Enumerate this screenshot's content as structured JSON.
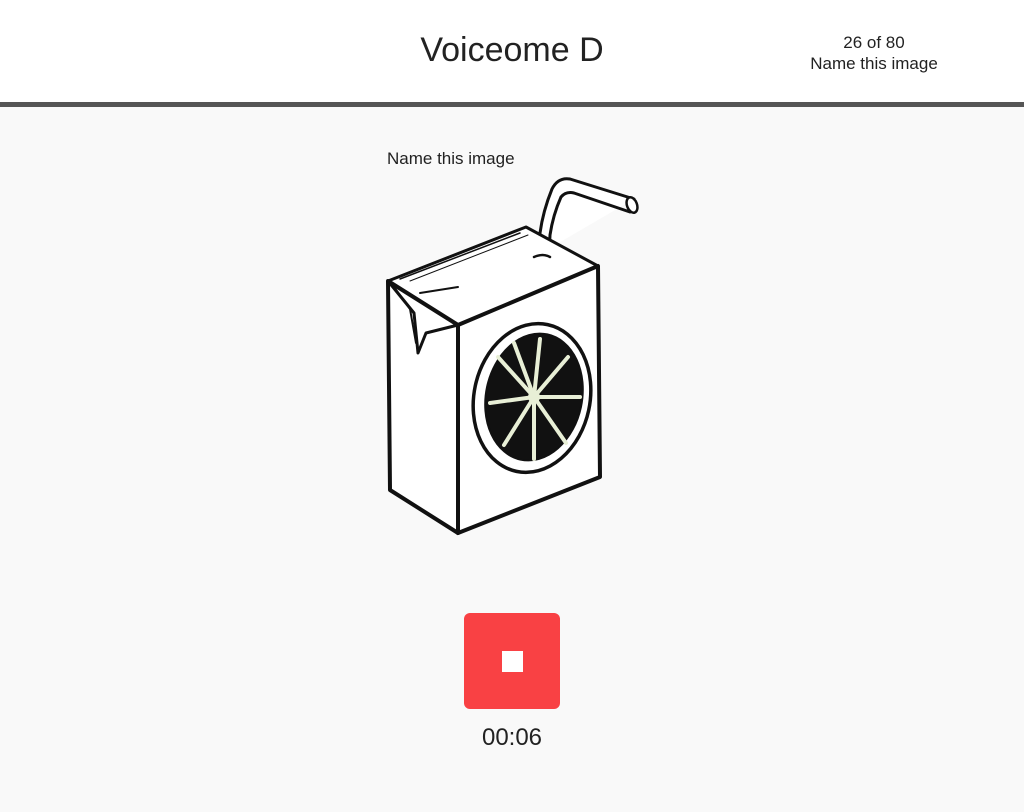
{
  "header": {
    "title": "Voiceome D",
    "progress": "26 of 80",
    "task_label": "Name this image"
  },
  "task": {
    "prompt": "Name this image",
    "image_subject": "juice box with straw and orange slice"
  },
  "recorder": {
    "state": "recording",
    "button_icon": "stop-icon",
    "elapsed": "00:06",
    "button_color": "#f94144"
  }
}
